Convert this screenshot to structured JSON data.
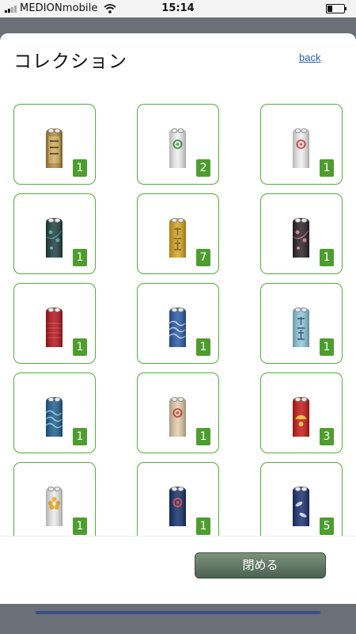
{
  "status": {
    "carrier": "MEDIONmobile",
    "time": "15:14"
  },
  "header": {
    "title": "コレクション",
    "back_label": "back"
  },
  "items": [
    {
      "count": "1",
      "icon": "gold-plaque-amulet-icon",
      "base": "#b38a3a",
      "accent": "#e3c77a",
      "pattern": "plaque"
    },
    {
      "count": "2",
      "icon": "white-amulet-green-crest-icon",
      "base": "#efefef",
      "accent": "#2f8f3a",
      "pattern": "crest"
    },
    {
      "count": "1",
      "icon": "white-amulet-red-crest-icon",
      "base": "#efefef",
      "accent": "#d43a3a",
      "pattern": "crest"
    },
    {
      "count": "1",
      "icon": "teal-pattern-amulet-icon",
      "base": "#1f3f3f",
      "accent": "#4fb0a8",
      "pattern": "floral"
    },
    {
      "count": "7",
      "icon": "gold-kanji-amulet-icon",
      "base": "#d8a522",
      "accent": "#6a4a10",
      "pattern": "kanji"
    },
    {
      "count": "1",
      "icon": "black-sakura-amulet-icon",
      "base": "#2a2228",
      "accent": "#e07aa0",
      "pattern": "floral"
    },
    {
      "count": "1",
      "icon": "red-amulet-icon",
      "base": "#b5141c",
      "accent": "#e04a4a",
      "pattern": "stripe"
    },
    {
      "count": "1",
      "icon": "blue-wave-amulet-icon",
      "base": "#2a5aa6",
      "accent": "#cfe0ff",
      "pattern": "wave"
    },
    {
      "count": "1",
      "icon": "light-blue-kanji-amulet-icon",
      "base": "#8ec8dc",
      "accent": "#1c3c5c",
      "pattern": "kanji"
    },
    {
      "count": "1",
      "icon": "seigaiha-wave-amulet-icon",
      "base": "#1f5f8f",
      "accent": "#9fd0ef",
      "pattern": "wave"
    },
    {
      "count": "1",
      "icon": "beige-maneki-neko-amulet-icon",
      "base": "#e3ccab",
      "accent": "#c23a2a",
      "pattern": "crest"
    },
    {
      "count": "3",
      "icon": "red-gold-fan-amulet-icon",
      "base": "#c81818",
      "accent": "#f0c030",
      "pattern": "fan"
    },
    {
      "count": "1",
      "icon": "white-gold-flower-amulet-icon",
      "base": "#eaeaea",
      "accent": "#f0a81e",
      "pattern": "flower"
    },
    {
      "count": "1",
      "icon": "navy-red-blossom-amulet-icon",
      "base": "#14306a",
      "accent": "#e03a3a",
      "pattern": "crest"
    },
    {
      "count": "5",
      "icon": "navy-koi-amulet-icon",
      "base": "#1b2f6e",
      "accent": "#cfd8ff",
      "pattern": "koi"
    }
  ],
  "footer": {
    "close_label": "閉める"
  }
}
